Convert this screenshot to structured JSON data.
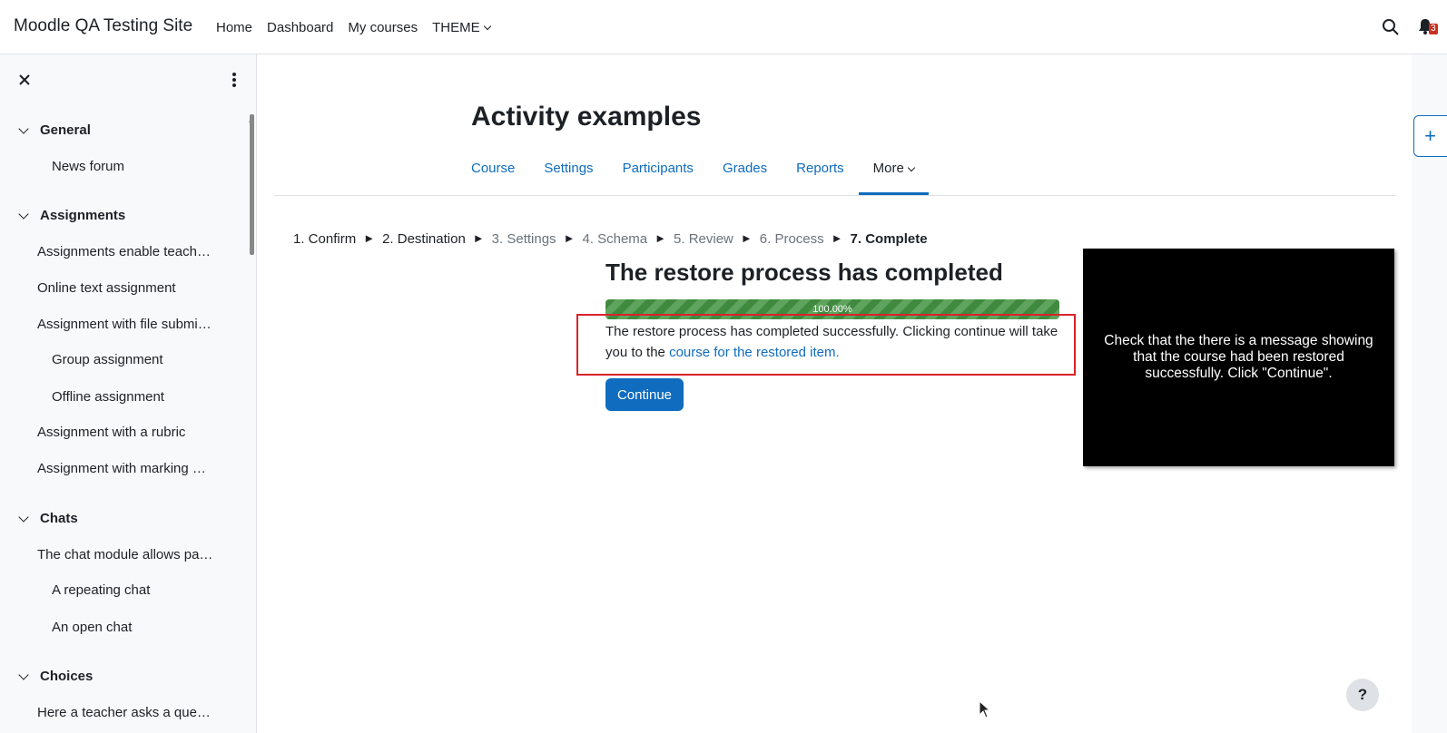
{
  "navbar": {
    "site_name": "Moodle QA Testing Site",
    "items": [
      {
        "label": "Home"
      },
      {
        "label": "Dashboard"
      },
      {
        "label": "My courses"
      },
      {
        "label": "THEME"
      }
    ],
    "notification_count": "3"
  },
  "drawer": {
    "sections": [
      {
        "title": "General",
        "items": [
          {
            "label": "News forum"
          }
        ]
      },
      {
        "title": "Assignments",
        "items": [
          {
            "label": "Assignments enable teach…"
          },
          {
            "label": "Online text assignment"
          },
          {
            "label": "Assignment with file submi…"
          },
          {
            "label": "Group assignment"
          },
          {
            "label": "Offline assignment"
          },
          {
            "label": "Assignment with a rubric"
          },
          {
            "label": "Assignment with marking …"
          }
        ]
      },
      {
        "title": "Chats",
        "items": [
          {
            "label": "The chat module allows pa…"
          },
          {
            "label": "A repeating chat"
          },
          {
            "label": "An open chat"
          }
        ]
      },
      {
        "title": "Choices",
        "items": [
          {
            "label": "Here a teacher asks a que…"
          }
        ]
      }
    ]
  },
  "page": {
    "title": "Activity examples",
    "tabs": [
      {
        "label": "Course"
      },
      {
        "label": "Settings"
      },
      {
        "label": "Participants"
      },
      {
        "label": "Grades"
      },
      {
        "label": "Reports"
      },
      {
        "label": "More"
      }
    ],
    "steps": [
      {
        "label": "1. Confirm"
      },
      {
        "label": "2. Destination"
      },
      {
        "label": "3. Settings"
      },
      {
        "label": "4. Schema"
      },
      {
        "label": "5. Review"
      },
      {
        "label": "6. Process"
      },
      {
        "label": "7. Complete"
      }
    ],
    "step_separator": "►",
    "restore_title": "The restore process has completed",
    "progress_label": "100.00%",
    "progress_value": 1.0,
    "message_text": "The restore process has completed successfully. Clicking continue will take you to the ",
    "message_link": "course for the restored item.",
    "continue_label": "Continue",
    "note_text": "Check that the there is a message showing that the course had been restored successfully. Click \"Continue\".",
    "help_label": "?",
    "block_toggle_label": "+"
  },
  "colors": {
    "link": "#0f6cbf",
    "progress": "#3f8a3f",
    "highlight": "#d9232a",
    "badge": "#ca3120"
  }
}
